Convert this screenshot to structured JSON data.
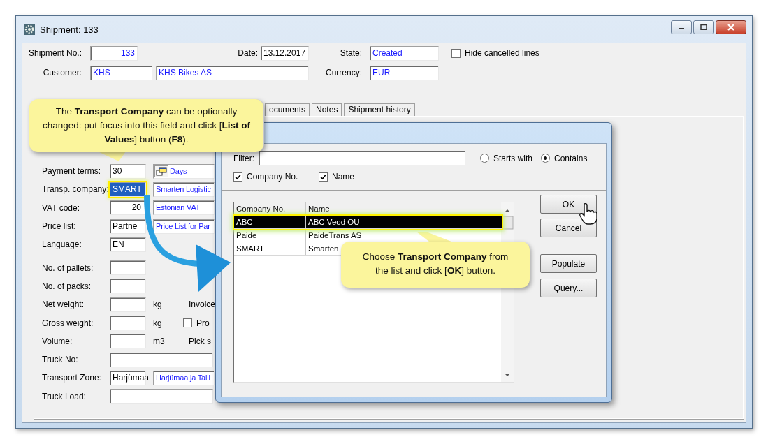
{
  "window": {
    "title": "Shipment: 133"
  },
  "header": {
    "shipment_no": {
      "label": "Shipment No.:",
      "value": "133"
    },
    "date": {
      "label": "Date:",
      "value": "13.12.2017"
    },
    "state": {
      "label": "State:",
      "value": "Created"
    },
    "hide_cancelled": {
      "label": "Hide cancelled lines",
      "checked": false
    },
    "customer": {
      "label": "Customer:",
      "code": "KHS",
      "name": "KHS Bikes AS"
    },
    "currency": {
      "label": "Currency:",
      "value": "EUR"
    }
  },
  "tabs": [
    {
      "label": "ocuments",
      "selected": false
    },
    {
      "label": "Notes",
      "selected": false
    },
    {
      "label": "Shipment history",
      "selected": false
    }
  ],
  "form": {
    "groups": [
      [
        {
          "label": "Payment terms:",
          "parts": [
            {
              "kind": "code",
              "value": "30"
            },
            {
              "kind": "name",
              "value": "Days",
              "lov_icon": true
            }
          ]
        },
        {
          "label": "Transp. company:",
          "parts": [
            {
              "kind": "code",
              "value": "SMART",
              "highlighted": true
            },
            {
              "kind": "name",
              "value": "Smarten Logistic"
            }
          ]
        },
        {
          "label": "VAT code:",
          "parts": [
            {
              "kind": "number",
              "value": "20"
            },
            {
              "kind": "name",
              "value": "Estonian VAT"
            }
          ]
        },
        {
          "label": "Price list:",
          "parts": [
            {
              "kind": "code",
              "value": "Partne"
            },
            {
              "kind": "name",
              "value": "Price List for Par"
            }
          ]
        },
        {
          "label": "Language:",
          "parts": [
            {
              "kind": "code",
              "value": "EN"
            }
          ]
        }
      ],
      [
        {
          "label": "No. of pallets:",
          "parts": [
            {
              "kind": "code"
            }
          ]
        },
        {
          "label": "No. of packs:",
          "parts": [
            {
              "kind": "code"
            }
          ]
        },
        {
          "label": "Net weight:",
          "parts": [
            {
              "kind": "code"
            },
            {
              "kind": "unit",
              "value": "kg"
            },
            {
              "kind": "text",
              "value": "Invoice"
            }
          ]
        },
        {
          "label": "Gross weight:",
          "parts": [
            {
              "kind": "code"
            },
            {
              "kind": "unit",
              "value": "kg"
            },
            {
              "kind": "check",
              "value": "Pro",
              "checked": false
            }
          ]
        },
        {
          "label": "Volume:",
          "parts": [
            {
              "kind": "code"
            },
            {
              "kind": "unit",
              "value": "m3"
            },
            {
              "kind": "text",
              "value": "Pick s"
            }
          ]
        },
        {
          "label": "Truck No:",
          "parts": [
            {
              "kind": "wide"
            }
          ]
        },
        {
          "label": "Transport Zone:",
          "parts": [
            {
              "kind": "code",
              "value": "Harjümaa"
            },
            {
              "kind": "name",
              "value": "Harjümaa ja Talli"
            }
          ]
        },
        {
          "label": "Truck Load:",
          "parts": [
            {
              "kind": "wide"
            }
          ]
        }
      ]
    ]
  },
  "dialog": {
    "filter": {
      "label": "Filter:"
    },
    "match_options": [
      {
        "label": "Starts with",
        "selected": false
      },
      {
        "label": "Contains",
        "selected": true
      }
    ],
    "search_in": [
      {
        "label": "Company No.",
        "checked": true
      },
      {
        "label": "Name",
        "checked": true
      }
    ],
    "columns": [
      "Company No.",
      "Name"
    ],
    "rows": [
      {
        "cells": [
          "ABC",
          "ABC Veod OÜ"
        ],
        "selected": true
      },
      {
        "cells": [
          "Paide",
          "PaideTrans AS"
        ],
        "selected": false
      },
      {
        "cells": [
          "SMART",
          "Smarten"
        ],
        "selected": false
      }
    ],
    "buttons": [
      "OK",
      "Cancel",
      "Populate",
      "Query..."
    ]
  },
  "callouts": [
    {
      "text": "The **Transport Company** can be optionally changed: put focus into this field and click [**List of Values**] button (**F8**)."
    },
    {
      "text": "Choose **Transport Company** from the list and click [**OK**] button."
    }
  ]
}
